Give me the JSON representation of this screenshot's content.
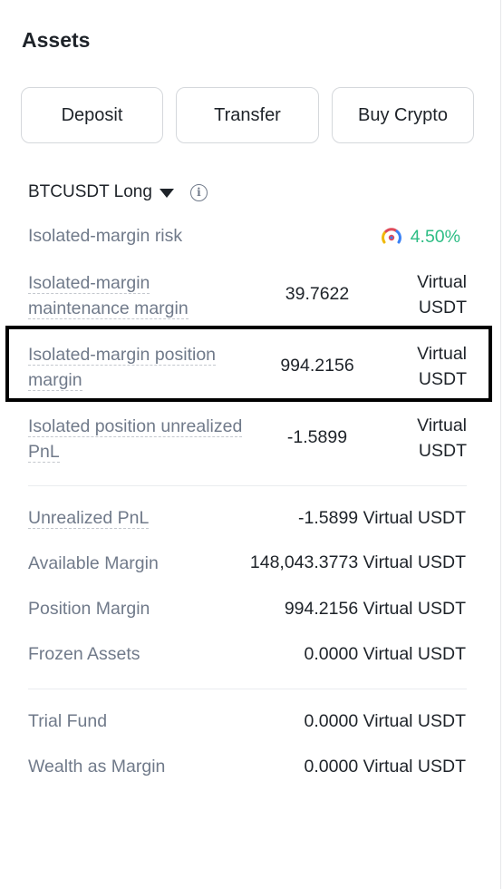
{
  "assets": {
    "title": "Assets",
    "buttons": {
      "deposit": "Deposit",
      "transfer": "Transfer",
      "buy_crypto": "Buy Crypto"
    }
  },
  "position": {
    "symbol_label": "BTCUSDT Long",
    "dropdown_icon": "caret-down-icon",
    "info_icon": "info-icon",
    "isolated_margin_risk": {
      "label": "Isolated-margin risk",
      "value": "4.50%",
      "icon": "risk-gauge-icon"
    },
    "maintenance_margin": {
      "label_line1": "Isolated-margin",
      "label_line2": "maintenance margin",
      "value": "39.7622",
      "unit_line1": "Virtual",
      "unit_line2": "USDT"
    },
    "position_margin": {
      "label_line1": "Isolated-margin position",
      "label_line2": "margin",
      "value": "994.2156",
      "unit_line1": "Virtual",
      "unit_line2": "USDT"
    },
    "unrealized_pnl": {
      "label_line1": "Isolated position unrealized",
      "label_line2": "PnL",
      "value": "-1.5899",
      "unit_line1": "Virtual",
      "unit_line2": "USDT"
    }
  },
  "summary": {
    "unrealized_pnl": {
      "label": "Unrealized PnL",
      "value": "-1.5899 Virtual USDT"
    },
    "available_margin": {
      "label": "Available Margin",
      "value": "148,043.3773 Virtual USDT"
    },
    "position_margin": {
      "label": "Position Margin",
      "value": "994.2156 Virtual USDT"
    },
    "frozen_assets": {
      "label": "Frozen Assets",
      "value": "0.0000 Virtual USDT"
    }
  },
  "extra": {
    "trial_fund": {
      "label": "Trial Fund",
      "value": "0.0000 Virtual USDT"
    },
    "wealth_as_margin": {
      "label": "Wealth as Margin",
      "value": "0.0000 Virtual USDT"
    }
  },
  "colors": {
    "positive": "#2ebd85",
    "highlight_border": "#000000"
  }
}
